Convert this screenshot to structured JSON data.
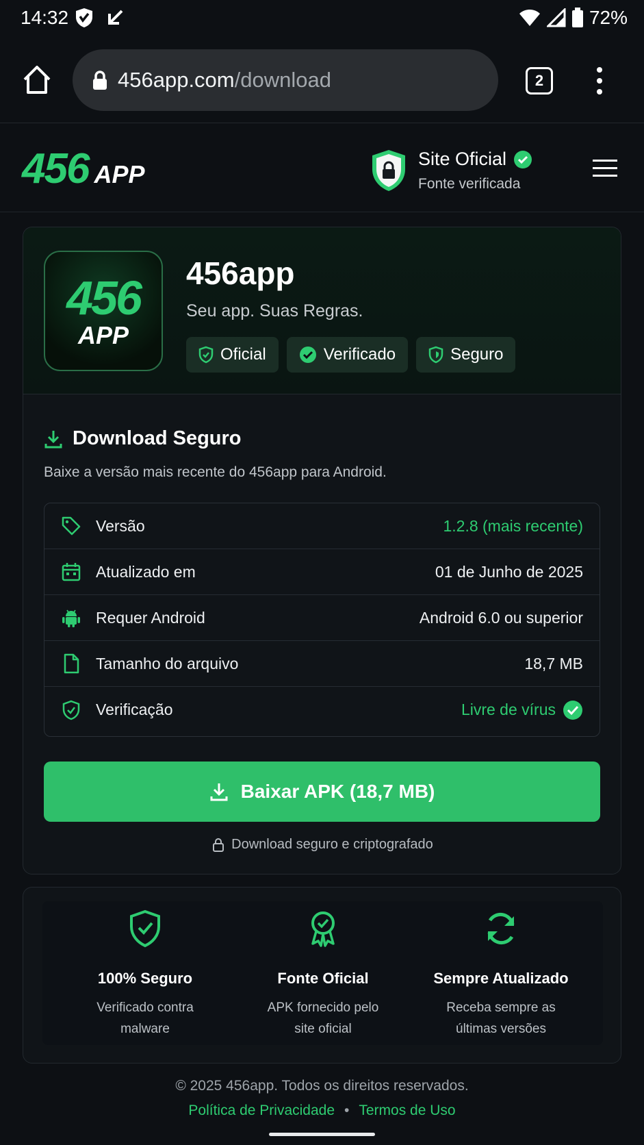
{
  "status_bar": {
    "time": "14:32",
    "battery": "72%"
  },
  "browser": {
    "url_host": "456app.com",
    "url_path": "/download",
    "tab_count": "2"
  },
  "header": {
    "logo_num": "456",
    "logo_app": "APP",
    "official_title": "Site Oficial",
    "official_subtitle": "Fonte verificada"
  },
  "app": {
    "icon_num": "456",
    "icon_app": "APP",
    "name": "456app",
    "tagline": "Seu app. Suas Regras.",
    "chips": [
      "Oficial",
      "Verificado",
      "Seguro"
    ]
  },
  "download": {
    "title": "Download Seguro",
    "description": "Baixe a versão mais recente do 456app para Android.",
    "rows": [
      {
        "label": "Versão",
        "value": "1.2.8 (mais recente)",
        "icon": "tag-icon"
      },
      {
        "label": "Atualizado em",
        "value": "01 de Junho de 2025",
        "icon": "calendar-icon"
      },
      {
        "label": "Requer Android",
        "value": "Android 6.0 ou superior",
        "icon": "android-icon"
      },
      {
        "label": "Tamanho do arquivo",
        "value": "18,7 MB",
        "icon": "file-icon"
      },
      {
        "label": "Verificação",
        "value": "Livre de vírus",
        "icon": "shield-check-icon"
      }
    ],
    "button_label": "Baixar APK (18,7 MB)",
    "secure_note": "Download seguro e criptografado"
  },
  "features": [
    {
      "title": "100% Seguro",
      "line1": "Verificado contra",
      "line2": "malware",
      "icon": "shield-check-icon"
    },
    {
      "title": "Fonte Oficial",
      "line1": "APK fornecido pelo",
      "line2": "site oficial",
      "icon": "award-icon"
    },
    {
      "title": "Sempre Atualizado",
      "line1": "Receba sempre as",
      "line2": "últimas versões",
      "icon": "refresh-icon"
    }
  ],
  "footer": {
    "copyright": "© 2025 456app. Todos os direitos reservados.",
    "privacy": "Política de Privacidade",
    "separator": "•",
    "terms": "Termos de Uso"
  },
  "colors": {
    "accent": "#2ecc71",
    "button": "#2fbf6a",
    "background": "#0d1014"
  }
}
